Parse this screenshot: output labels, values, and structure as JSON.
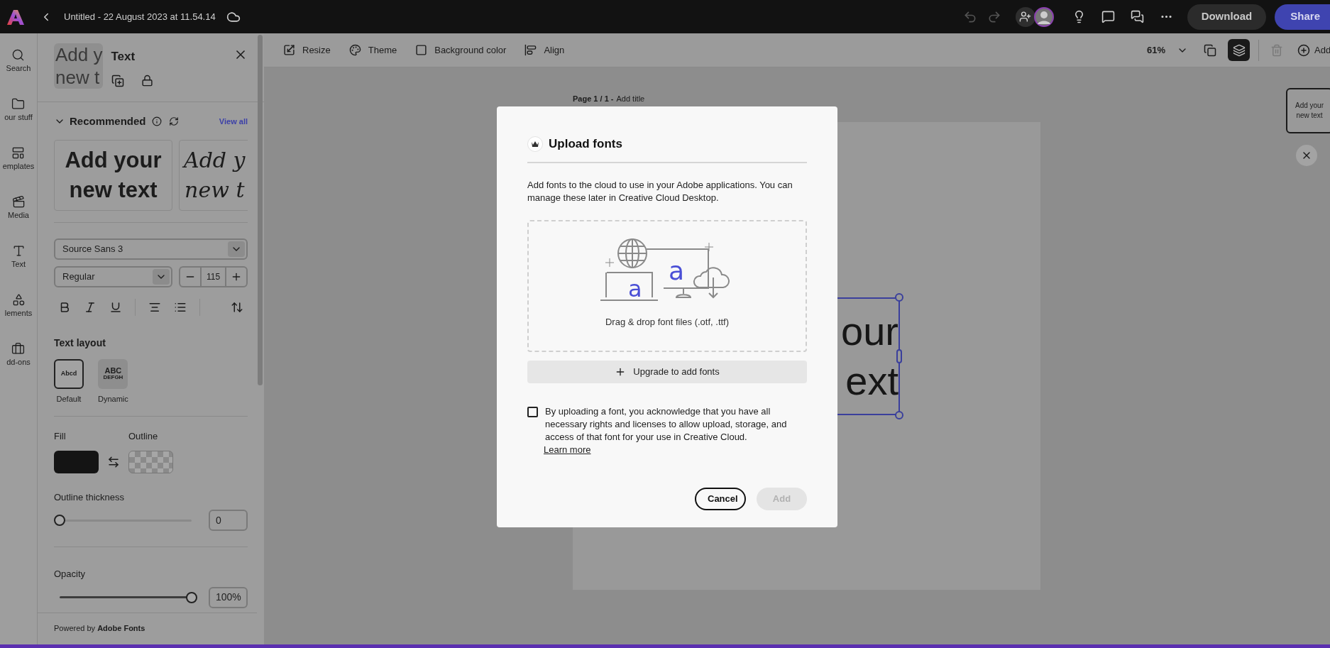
{
  "top_bar": {
    "title": "Untitled - 22 August 2023 at 11.54.14",
    "download": "Download",
    "share": "Share"
  },
  "rail": [
    {
      "kind": "search",
      "label": "Search"
    },
    {
      "kind": "folder",
      "label": "our stuff"
    },
    {
      "kind": "templates",
      "label": "emplates"
    },
    {
      "kind": "media",
      "label": "Media"
    },
    {
      "kind": "text",
      "label": "Text"
    },
    {
      "kind": "elements",
      "label": "lements"
    },
    {
      "kind": "addons",
      "label": "dd-ons"
    }
  ],
  "panel": {
    "thumbnail": [
      "Add y",
      "new t"
    ],
    "title": "Text",
    "recommended": {
      "heading": "Recommended",
      "expanded": true,
      "view_all": "View all",
      "previews": [
        {
          "kind": "bold-sans",
          "lines": [
            "Add your",
            "new text"
          ]
        },
        {
          "kind": "italic-serif",
          "lines": [
            "Add y",
            "new t"
          ]
        }
      ]
    },
    "font": "Source Sans 3",
    "style": "Regular",
    "size": "115",
    "layout": {
      "heading": "Text layout",
      "options": [
        {
          "kind": "default",
          "tile": [
            "Abcd"
          ],
          "label": "Default",
          "selected": true
        },
        {
          "kind": "dynamic",
          "tile": [
            "ABC",
            "DEFGH"
          ],
          "label": "Dynamic",
          "selected": false
        }
      ]
    },
    "fill_label": "Fill",
    "outline_label": "Outline",
    "outline_thickness": {
      "label": "Outline thickness",
      "level": 0,
      "value": "0"
    },
    "opacity": {
      "label": "Opacity",
      "level": 1,
      "value": "100%"
    },
    "footer": "Powered by **Adobe Fonts**"
  },
  "toolbar": {
    "items": [
      {
        "kind": "resize",
        "label": "Resize"
      },
      {
        "kind": "theme",
        "label": "Theme"
      },
      {
        "kind": "background",
        "label": "Background color"
      },
      {
        "kind": "align",
        "label": "Align"
      }
    ],
    "zoom": "61%",
    "add": "Add"
  },
  "canvas": {
    "page_label": "Page 1 / 1 -",
    "page_title": "Add title",
    "text_lines": [
      "our",
      "ext"
    ],
    "floating_thumbnail": "Add your new text"
  },
  "dialog": {
    "title": "Upload fonts",
    "description": "Add fonts to the cloud to use in your Adobe applications. You can manage these later in Creative Cloud Desktop.",
    "illustration_letters": [
      "a",
      "a"
    ],
    "drop_hint": "Drag & drop font files (.otf, .ttf)",
    "upgrade": "Upgrade to add fonts",
    "consent": {
      "checked": false,
      "text": "By uploading a font, you acknowledge that you have all necessary rights and licenses to allow upload, storage, and access of that font for your use in Creative Cloud.",
      "link": "Learn more"
    },
    "buttons": [
      {
        "kind": "secondary",
        "label": "Cancel",
        "disabled": false
      },
      {
        "kind": "primary",
        "label": "Add",
        "disabled": true
      }
    ]
  }
}
